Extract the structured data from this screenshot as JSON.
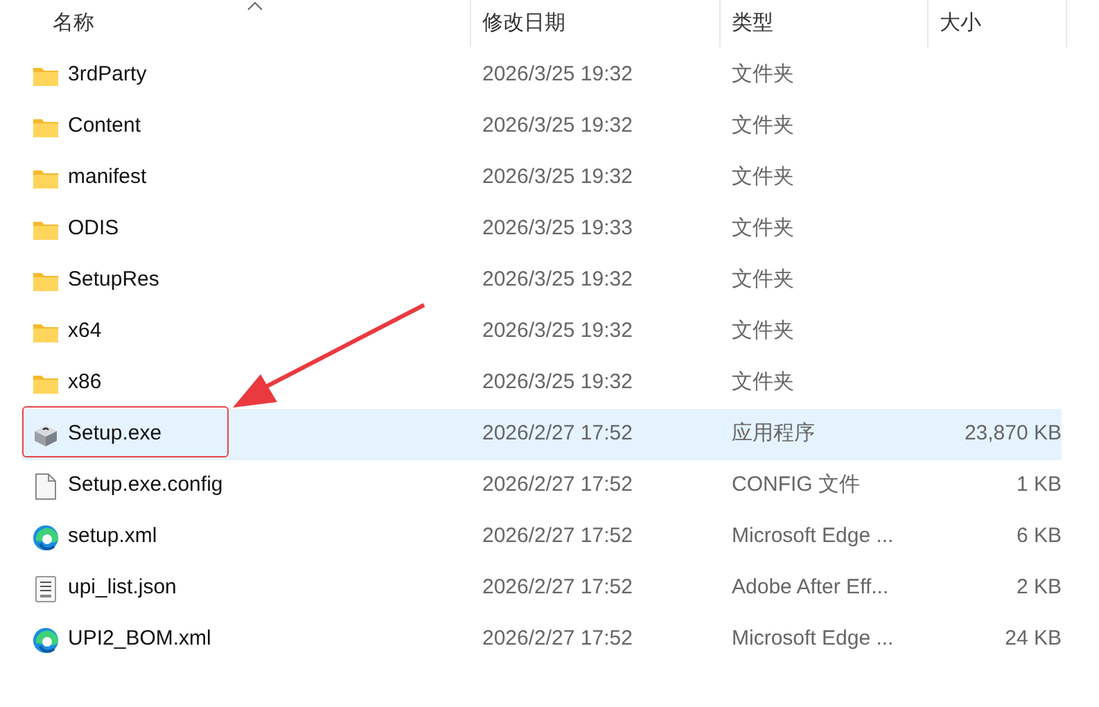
{
  "columns": [
    {
      "label": "名称",
      "sorted": true
    },
    {
      "label": "修改日期",
      "sorted": false
    },
    {
      "label": "类型",
      "sorted": false
    },
    {
      "label": "大小",
      "sorted": false
    }
  ],
  "rows": [
    {
      "kind": "folder",
      "name": "3rdParty",
      "date": "2026/3/25 19:32",
      "type": "文件夹",
      "selected": false,
      "annotated": false
    },
    {
      "kind": "folder",
      "name": "Content",
      "date": "2026/3/25 19:32",
      "type": "文件夹",
      "selected": false,
      "annotated": false
    },
    {
      "kind": "folder",
      "name": "manifest",
      "date": "2026/3/25 19:32",
      "type": "文件夹",
      "selected": false,
      "annotated": false
    },
    {
      "kind": "folder",
      "name": "ODIS",
      "date": "2026/3/25 19:33",
      "type": "文件夹",
      "selected": false,
      "annotated": false
    },
    {
      "kind": "folder",
      "name": "SetupRes",
      "date": "2026/3/25 19:32",
      "type": "文件夹",
      "selected": false,
      "annotated": false
    },
    {
      "kind": "folder",
      "name": "x64",
      "date": "2026/3/25 19:32",
      "type": "文件夹",
      "selected": false,
      "annotated": false
    },
    {
      "kind": "folder",
      "name": "x86",
      "date": "2026/3/25 19:32",
      "type": "文件夹",
      "selected": false,
      "annotated": false
    },
    {
      "kind": "installer",
      "name": "Setup.exe",
      "date": "2026/2/27 17:52",
      "type": "应用程序",
      "size": "23,870 KB",
      "selected": true,
      "annotated": true
    },
    {
      "kind": "file",
      "name": "Setup.exe.config",
      "date": "2026/2/27 17:52",
      "type": "CONFIG 文件",
      "size": "1 KB",
      "selected": false,
      "annotated": false
    },
    {
      "kind": "browser",
      "name": "setup.xml",
      "date": "2026/2/27 17:52",
      "type": "Microsoft Edge ...",
      "size": "6 KB",
      "selected": false,
      "annotated": false
    },
    {
      "kind": "json",
      "name": "upi_list.json",
      "date": "2026/2/27 17:52",
      "type": "Adobe After Eff...",
      "size": "2 KB",
      "selected": false,
      "annotated": false
    },
    {
      "kind": "browser",
      "name": "UPI2_BOM.xml",
      "date": "2026/2/27 17:52",
      "type": "Microsoft Edge ...",
      "size": "24 KB",
      "selected": false,
      "annotated": false
    }
  ]
}
